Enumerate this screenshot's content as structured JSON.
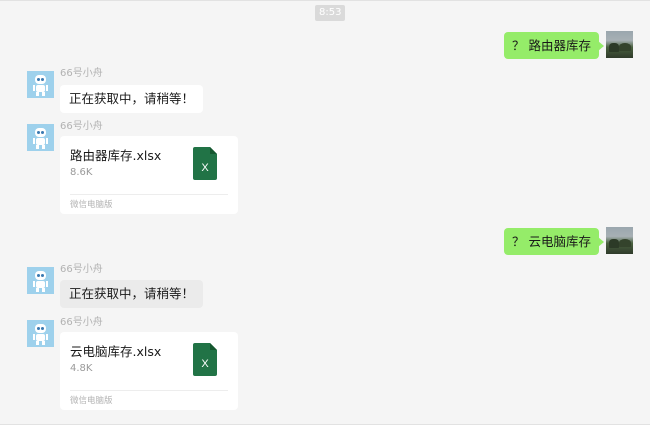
{
  "timestamp": "8:53",
  "messages": {
    "m1": {
      "text": "？ 路由器库存"
    },
    "m2": {
      "sender": "66号小舟",
      "text": "正在获取中，请稍等！"
    },
    "m3": {
      "sender": "66号小舟",
      "file_name": "路由器库存.xlsx",
      "file_size": "8.6K",
      "source": "微信电脑版",
      "icon_letter": "X"
    },
    "m4": {
      "text": "？ 云电脑库存"
    },
    "m5": {
      "sender": "66号小舟",
      "text": "正在获取中，请稍等！"
    },
    "m6": {
      "sender": "66号小舟",
      "file_name": "云电脑库存.xlsx",
      "file_size": "4.8K",
      "source": "微信电脑版",
      "icon_letter": "X"
    }
  },
  "colors": {
    "chat_bg": "#f5f5f5",
    "sent_bubble": "#95ec69",
    "excel_green": "#217346"
  },
  "icons": {
    "user_avatar": "landscape-photo-avatar",
    "bot_avatar": "robot-avatar",
    "file_icon": "excel-file-icon"
  }
}
